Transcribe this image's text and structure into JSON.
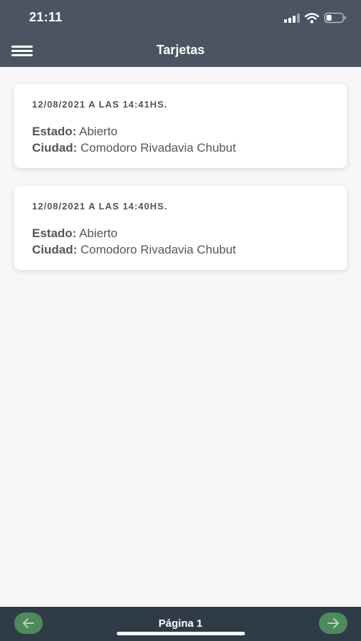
{
  "status_bar": {
    "time": "21:11",
    "icons": [
      "cellular-signal-icon",
      "wifi-icon",
      "battery-icon"
    ]
  },
  "header": {
    "title": "Tarjetas",
    "menu_icon": "hamburger-menu-icon"
  },
  "cards": [
    {
      "date": "12/08/2021 A LAS 14:41HS.",
      "estado_label": "Estado:",
      "estado_value": "Abierto",
      "ciudad_label": "Ciudad:",
      "ciudad_value": "Comodoro Rivadavia Chubut"
    },
    {
      "date": "12/08/2021 A LAS 14:40HS.",
      "estado_label": "Estado:",
      "estado_value": "Abierto",
      "ciudad_label": "Ciudad:",
      "ciudad_value": "Comodoro Rivadavia Chubut"
    }
  ],
  "footer": {
    "page_label": "Página 1",
    "prev_icon": "arrow-left-icon",
    "next_icon": "arrow-right-icon"
  },
  "colors": {
    "header_bg": "#4a5561",
    "footer_bg": "#2f3b47",
    "nav_button": "#4e8a5a",
    "page_bg": "#f7f7f7"
  }
}
